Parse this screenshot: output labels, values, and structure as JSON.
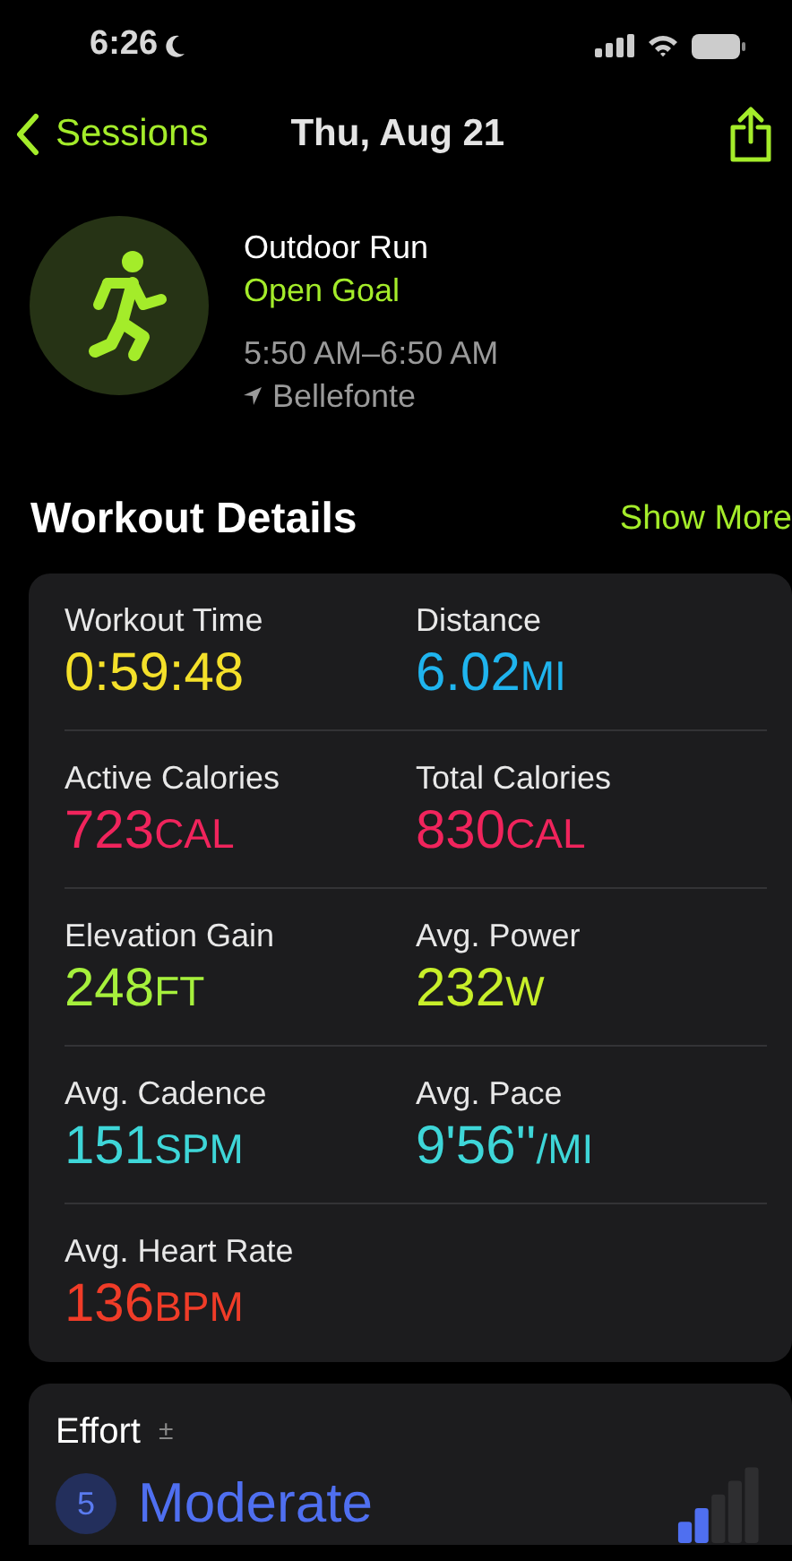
{
  "status_bar": {
    "time": "6:26"
  },
  "nav": {
    "back": "Sessions",
    "title": "Thu, Aug 21"
  },
  "workout": {
    "name": "Outdoor Run",
    "goal": "Open Goal",
    "time_range": "5:50 AM–6:50 AM",
    "location": "Bellefonte"
  },
  "section": {
    "title": "Workout Details",
    "action": "Show More"
  },
  "metrics": [
    {
      "label": "Workout Time",
      "value": "0:59:48",
      "color": "#f4e02a"
    },
    {
      "label": "Distance",
      "value": "6.02",
      "unit": "MI",
      "color": "#1fb4ee"
    },
    {
      "label": "Active Calories",
      "value": "723",
      "unit": "CAL",
      "color": "#f0245c"
    },
    {
      "label": "Total Calories",
      "value": "830",
      "unit": "CAL",
      "color": "#f0245c"
    },
    {
      "label": "Elevation Gain",
      "value": "248",
      "unit": "FT",
      "color": "#a6f03c"
    },
    {
      "label": "Avg. Power",
      "value": "232",
      "unit": "W",
      "color": "#c8ef2a"
    },
    {
      "label": "Avg. Cadence",
      "value": "151",
      "unit": "SPM",
      "color": "#3ed6d8"
    },
    {
      "label": "Avg. Pace",
      "value": "9'56''",
      "unit": "/MI",
      "color": "#3ed6d8"
    },
    {
      "label": "Avg. Heart Rate",
      "value": "136",
      "unit": "BPM",
      "color": "#f03c28"
    }
  ],
  "effort": {
    "title": "Effort",
    "symbol": "±",
    "score": "5",
    "rating": "Moderate",
    "level": 0.4
  }
}
